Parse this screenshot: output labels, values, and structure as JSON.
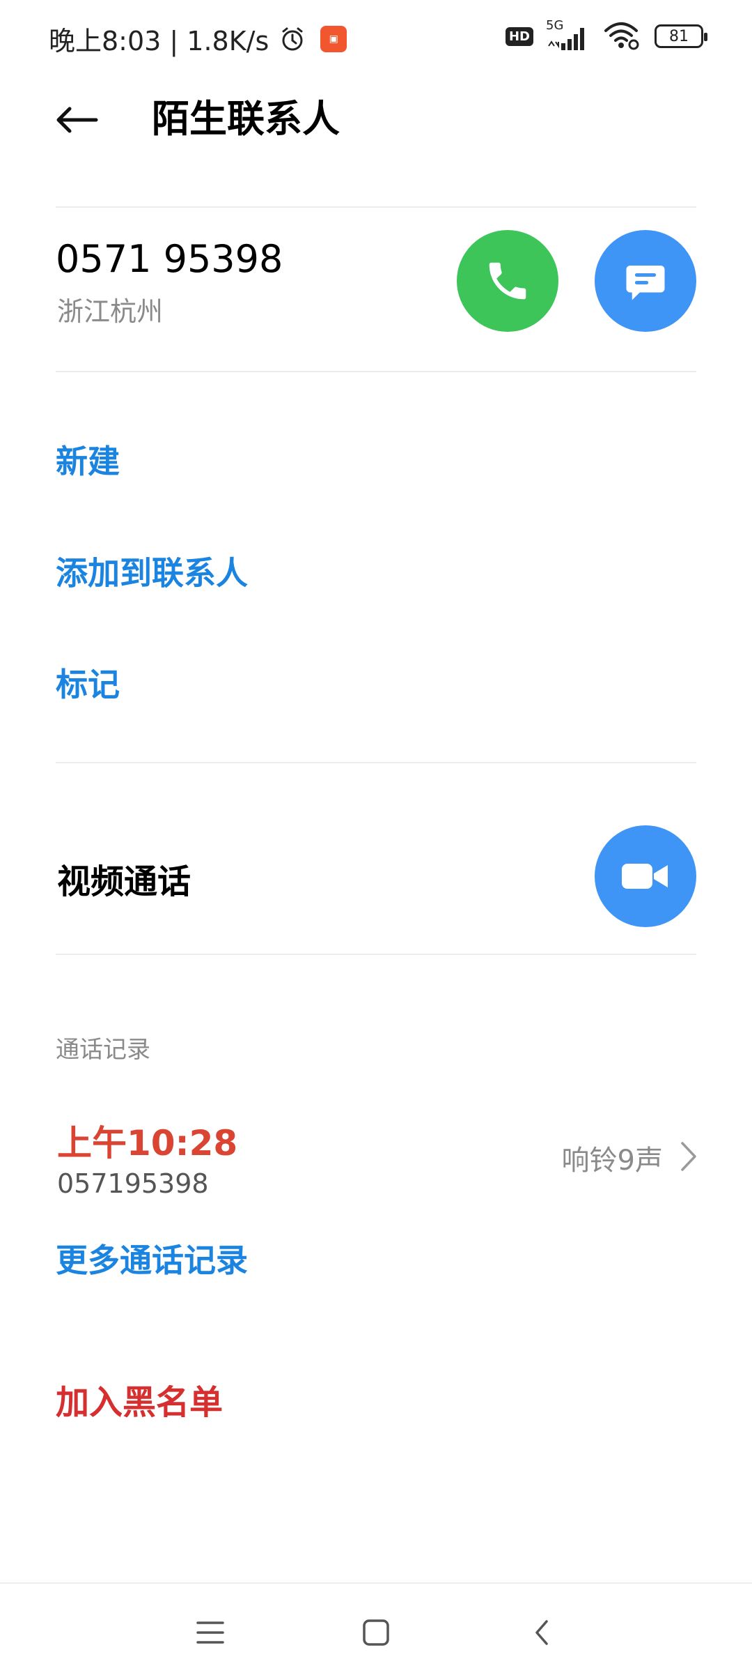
{
  "status_bar": {
    "time_speed": "晚上8:03 | 1.8K/s",
    "hd": "HD",
    "network": "5G",
    "battery": "81"
  },
  "header": {
    "title": "陌生联系人"
  },
  "contact": {
    "number": "0571 95398",
    "location": "浙江杭州"
  },
  "actions": {
    "new": "新建",
    "add_to_contacts": "添加到联系人",
    "mark": "标记"
  },
  "video_call": {
    "label": "视频通话"
  },
  "call_log": {
    "section_label": "通话记录",
    "entries": [
      {
        "time": "上午10:28",
        "number": "057195398",
        "detail": "响铃9声"
      }
    ],
    "more": "更多通话记录"
  },
  "blacklist": {
    "label": "加入黑名单"
  },
  "colors": {
    "accent_blue": "#1a84e0",
    "call_green": "#3dc55a",
    "button_blue": "#3f95f5",
    "missed_red": "#d94433",
    "danger_red": "#d62f2f"
  }
}
